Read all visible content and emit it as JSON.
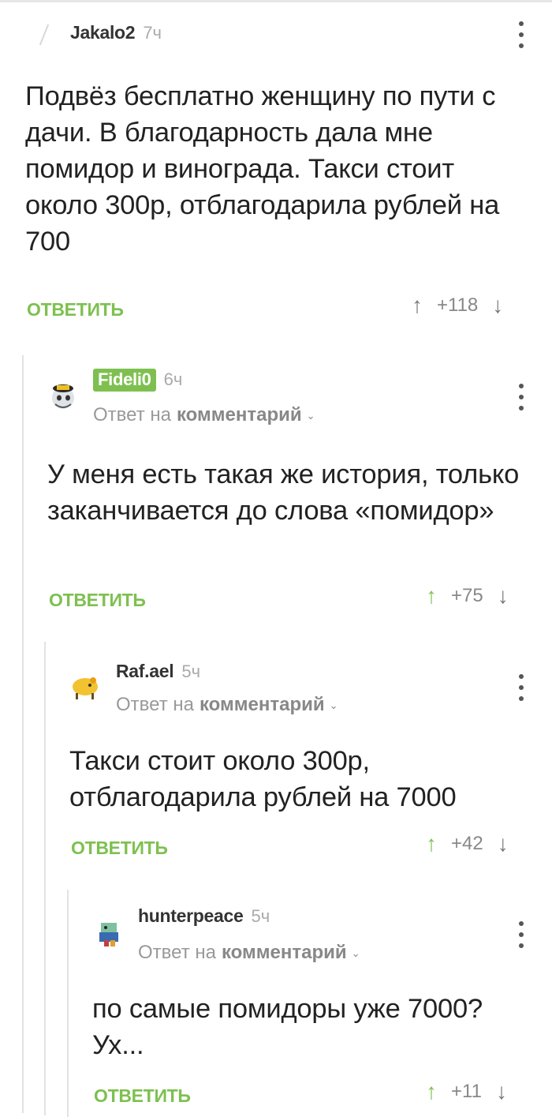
{
  "comments": [
    {
      "username": "Jakalo2",
      "time": "7ч",
      "text": "Подвёз бесплатно женщину по пути с дачи. В благодарность дала мне помидор и винограда. Такси стоит около 300р, отблагодарила рублей на 700",
      "reply_label": "ОТВЕТИТЬ",
      "score": "+118"
    },
    {
      "username": "Fideli0",
      "time": "6ч",
      "reply_to_prefix": "Ответ на",
      "reply_to_link": "комментарий",
      "text": "У меня есть такая же история, только заканчивается до слова «помидор»",
      "reply_label": "ОТВЕТИТЬ",
      "score": "+75"
    },
    {
      "username": "Raf.ael",
      "time": "5ч",
      "reply_to_prefix": "Ответ на",
      "reply_to_link": "комментарий",
      "text": "Такси стоит около 300р, отблагодарила рублей на 7000",
      "reply_label": "ОТВЕТИТЬ",
      "score": "+42"
    },
    {
      "username": "hunterpeace",
      "time": "5ч",
      "reply_to_prefix": "Ответ на",
      "reply_to_link": "комментарий",
      "text": "по самые помидоры уже 7000? Ух...",
      "reply_label": "ОТВЕТИТЬ",
      "score": "+11"
    }
  ],
  "icons": {
    "upvote": "arrow-up-icon",
    "downvote": "arrow-down-icon",
    "menu": "more-vertical-icon",
    "chevron": "chevron-down-icon"
  },
  "colors": {
    "accent": "#7ec050",
    "text": "#222222",
    "muted": "#999999"
  }
}
